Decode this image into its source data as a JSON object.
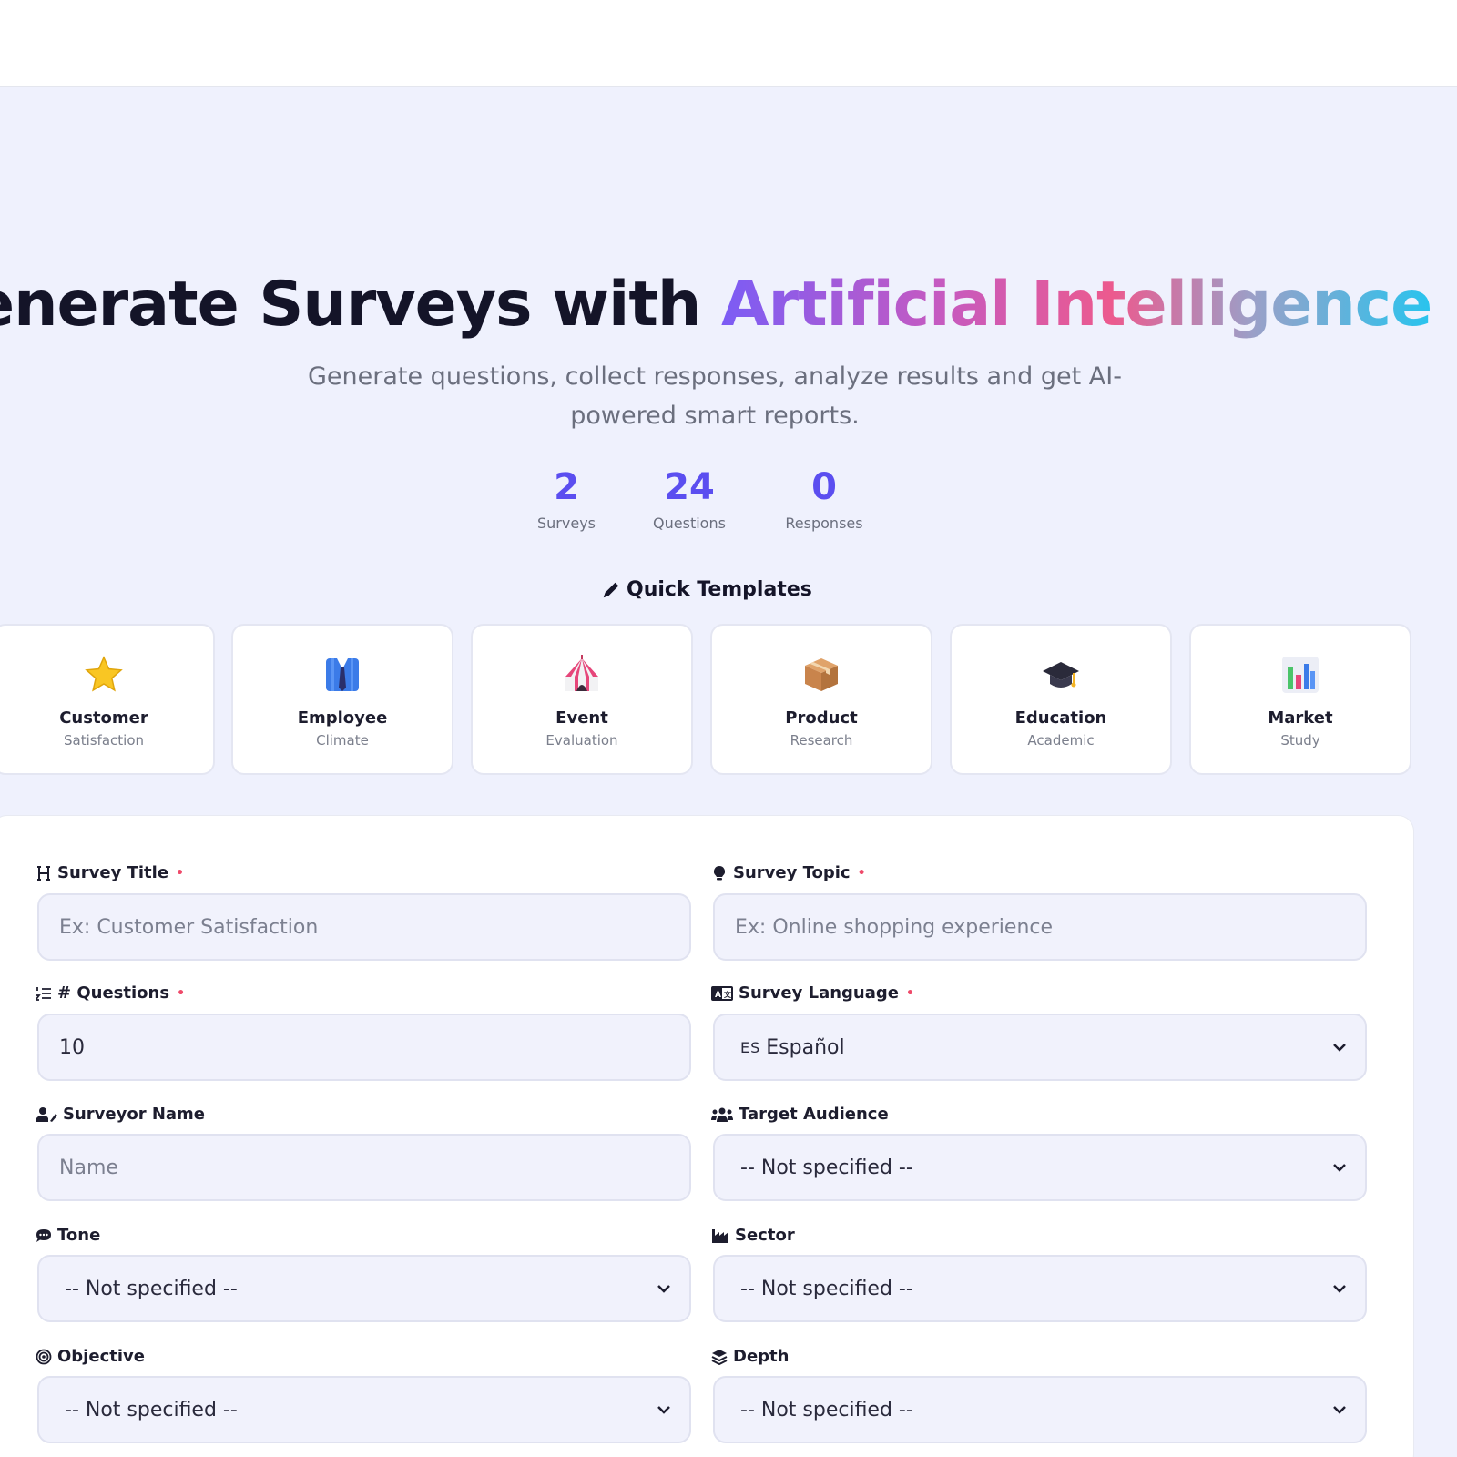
{
  "hero": {
    "title_plain": "enerate Surveys with ",
    "title_highlight": "Artificial Intelligence",
    "subtitle": "Generate questions, collect responses, analyze results and get AI-powered smart reports."
  },
  "stats": [
    {
      "value": "2",
      "label": "Surveys"
    },
    {
      "value": "24",
      "label": "Questions"
    },
    {
      "value": "0",
      "label": "Responses"
    }
  ],
  "quick_templates": {
    "title": "Quick Templates",
    "items": [
      {
        "name": "Customer",
        "sub": "Satisfaction",
        "icon": "star-icon"
      },
      {
        "name": "Employee",
        "sub": "Climate",
        "icon": "suit-icon"
      },
      {
        "name": "Event",
        "sub": "Evaluation",
        "icon": "circus-tent-icon"
      },
      {
        "name": "Product",
        "sub": "Research",
        "icon": "package-icon"
      },
      {
        "name": "Education",
        "sub": "Academic",
        "icon": "graduation-cap-icon"
      },
      {
        "name": "Market",
        "sub": "Study",
        "icon": "bar-chart-icon"
      }
    ]
  },
  "form": {
    "survey_title": {
      "label": "Survey Title",
      "placeholder": "Ex: Customer Satisfaction"
    },
    "survey_topic": {
      "label": "Survey Topic",
      "placeholder": "Ex: Online shopping experience"
    },
    "num_questions": {
      "label": "# Questions",
      "value": "10"
    },
    "survey_language": {
      "label": "Survey Language",
      "tag": "ES",
      "value": "Español"
    },
    "surveyor_name": {
      "label": "Surveyor Name",
      "placeholder": "Name"
    },
    "target_audience": {
      "label": "Target Audience",
      "value": "-- Not specified --"
    },
    "tone": {
      "label": "Tone",
      "value": "-- Not specified --"
    },
    "sector": {
      "label": "Sector",
      "value": "-- Not specified --"
    },
    "objective": {
      "label": "Objective",
      "value": "-- Not specified --"
    },
    "depth": {
      "label": "Depth",
      "value": "-- Not specified --"
    }
  },
  "colors": {
    "accent": "#5b4ef0",
    "required": "#ef4a6a",
    "background": "#eff1fd"
  }
}
